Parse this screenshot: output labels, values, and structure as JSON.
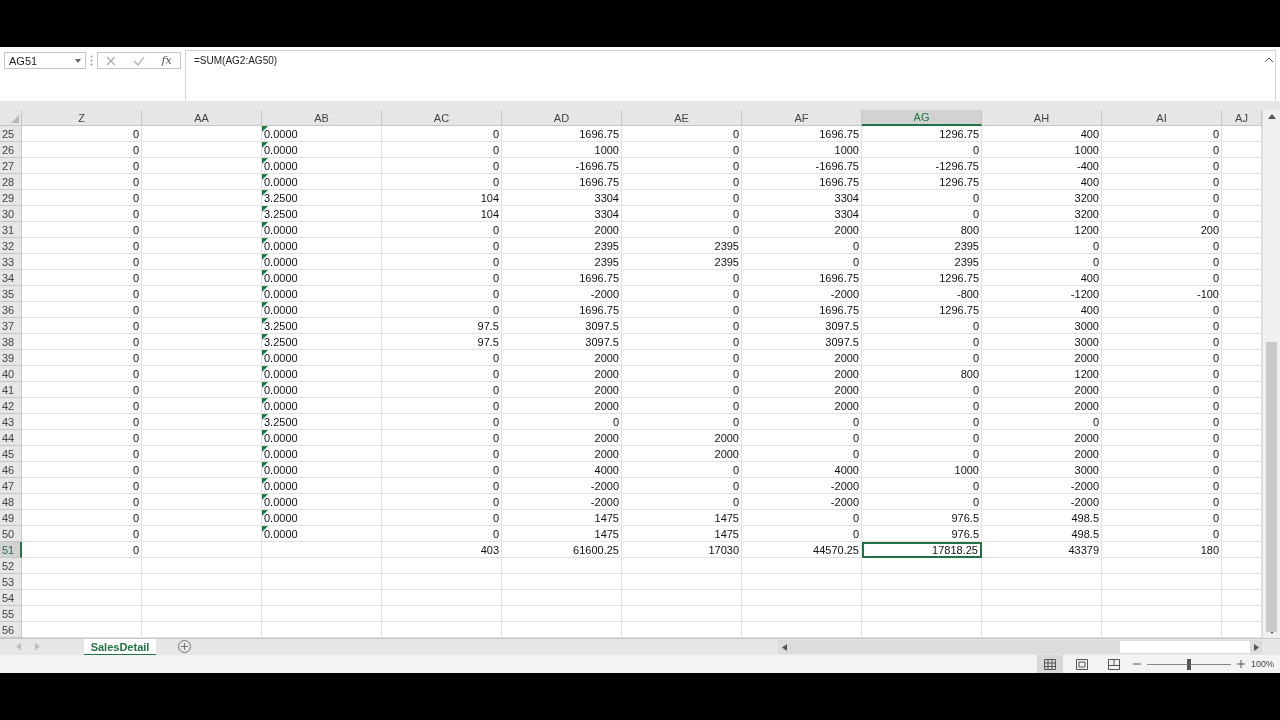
{
  "formula_bar": {
    "name_box": "AG51",
    "function_label": "fx",
    "formula": "=SUM(AG2:AG50)"
  },
  "columns": [
    {
      "label": "Z",
      "selected": false
    },
    {
      "label": "AA",
      "selected": false
    },
    {
      "label": "AB",
      "selected": false
    },
    {
      "label": "AC",
      "selected": false
    },
    {
      "label": "AD",
      "selected": false
    },
    {
      "label": "AE",
      "selected": false
    },
    {
      "label": "AF",
      "selected": false
    },
    {
      "label": "AG",
      "selected": true
    },
    {
      "label": "AH",
      "selected": false
    },
    {
      "label": "AI",
      "selected": false
    },
    {
      "label": "AJ",
      "selected": false
    }
  ],
  "rows": [
    {
      "number": "25",
      "selected": false,
      "cells": [
        "0",
        null,
        {
          "text": "0.0000",
          "flag": true
        },
        "0",
        "1696.75",
        "0",
        "1696.75",
        "1296.75",
        "400",
        "0"
      ]
    },
    {
      "number": "26",
      "selected": false,
      "cells": [
        "0",
        null,
        {
          "text": "0.0000",
          "flag": true
        },
        "0",
        "1000",
        "0",
        "1000",
        "0",
        "1000",
        "0"
      ]
    },
    {
      "number": "27",
      "selected": false,
      "cells": [
        "0",
        null,
        {
          "text": "0.0000",
          "flag": true
        },
        "0",
        "-1696.75",
        "0",
        "-1696.75",
        "-1296.75",
        "-400",
        "0"
      ]
    },
    {
      "number": "28",
      "selected": false,
      "cells": [
        "0",
        null,
        {
          "text": "0.0000",
          "flag": true
        },
        "0",
        "1696.75",
        "0",
        "1696.75",
        "1296.75",
        "400",
        "0"
      ]
    },
    {
      "number": "29",
      "selected": false,
      "cells": [
        "0",
        null,
        {
          "text": "3.2500",
          "flag": true
        },
        "104",
        "3304",
        "0",
        "3304",
        "0",
        "3200",
        "0"
      ]
    },
    {
      "number": "30",
      "selected": false,
      "cells": [
        "0",
        null,
        {
          "text": "3.2500",
          "flag": true
        },
        "104",
        "3304",
        "0",
        "3304",
        "0",
        "3200",
        "0"
      ]
    },
    {
      "number": "31",
      "selected": false,
      "cells": [
        "0",
        null,
        {
          "text": "0.0000",
          "flag": true
        },
        "0",
        "2000",
        "0",
        "2000",
        "800",
        "1200",
        "200"
      ]
    },
    {
      "number": "32",
      "selected": false,
      "cells": [
        "0",
        null,
        {
          "text": "0.0000",
          "flag": true
        },
        "0",
        "2395",
        "2395",
        "0",
        "2395",
        "0",
        "0"
      ]
    },
    {
      "number": "33",
      "selected": false,
      "cells": [
        "0",
        null,
        {
          "text": "0.0000",
          "flag": true
        },
        "0",
        "2395",
        "2395",
        "0",
        "2395",
        "0",
        "0"
      ]
    },
    {
      "number": "34",
      "selected": false,
      "cells": [
        "0",
        null,
        {
          "text": "0.0000",
          "flag": true
        },
        "0",
        "1696.75",
        "0",
        "1696.75",
        "1296.75",
        "400",
        "0"
      ]
    },
    {
      "number": "35",
      "selected": false,
      "cells": [
        "0",
        null,
        {
          "text": "0.0000",
          "flag": true
        },
        "0",
        "-2000",
        "0",
        "-2000",
        "-800",
        "-1200",
        "-100"
      ]
    },
    {
      "number": "36",
      "selected": false,
      "cells": [
        "0",
        null,
        {
          "text": "0.0000",
          "flag": true
        },
        "0",
        "1696.75",
        "0",
        "1696.75",
        "1296.75",
        "400",
        "0"
      ]
    },
    {
      "number": "37",
      "selected": false,
      "cells": [
        "0",
        null,
        {
          "text": "3.2500",
          "flag": true
        },
        "97.5",
        "3097.5",
        "0",
        "3097.5",
        "0",
        "3000",
        "0"
      ]
    },
    {
      "number": "38",
      "selected": false,
      "cells": [
        "0",
        null,
        {
          "text": "3.2500",
          "flag": true
        },
        "97.5",
        "3097.5",
        "0",
        "3097.5",
        "0",
        "3000",
        "0"
      ]
    },
    {
      "number": "39",
      "selected": false,
      "cells": [
        "0",
        null,
        {
          "text": "0.0000",
          "flag": true
        },
        "0",
        "2000",
        "0",
        "2000",
        "0",
        "2000",
        "0"
      ]
    },
    {
      "number": "40",
      "selected": false,
      "cells": [
        "0",
        null,
        {
          "text": "0.0000",
          "flag": true
        },
        "0",
        "2000",
        "0",
        "2000",
        "800",
        "1200",
        "0"
      ]
    },
    {
      "number": "41",
      "selected": false,
      "cells": [
        "0",
        null,
        {
          "text": "0.0000",
          "flag": true
        },
        "0",
        "2000",
        "0",
        "2000",
        "0",
        "2000",
        "0"
      ]
    },
    {
      "number": "42",
      "selected": false,
      "cells": [
        "0",
        null,
        {
          "text": "0.0000",
          "flag": true
        },
        "0",
        "2000",
        "0",
        "2000",
        "0",
        "2000",
        "0"
      ]
    },
    {
      "number": "43",
      "selected": false,
      "cells": [
        "0",
        null,
        {
          "text": "3.2500",
          "flag": true
        },
        "0",
        "0",
        "0",
        "0",
        "0",
        "0",
        "0"
      ]
    },
    {
      "number": "44",
      "selected": false,
      "cells": [
        "0",
        null,
        {
          "text": "0.0000",
          "flag": true
        },
        "0",
        "2000",
        "2000",
        "0",
        "0",
        "2000",
        "0"
      ]
    },
    {
      "number": "45",
      "selected": false,
      "cells": [
        "0",
        null,
        {
          "text": "0.0000",
          "flag": true
        },
        "0",
        "2000",
        "2000",
        "0",
        "0",
        "2000",
        "0"
      ]
    },
    {
      "number": "46",
      "selected": false,
      "cells": [
        "0",
        null,
        {
          "text": "0.0000",
          "flag": true
        },
        "0",
        "4000",
        "0",
        "4000",
        "1000",
        "3000",
        "0"
      ]
    },
    {
      "number": "47",
      "selected": false,
      "cells": [
        "0",
        null,
        {
          "text": "0.0000",
          "flag": true
        },
        "0",
        "-2000",
        "0",
        "-2000",
        "0",
        "-2000",
        "0"
      ]
    },
    {
      "number": "48",
      "selected": false,
      "cells": [
        "0",
        null,
        {
          "text": "0.0000",
          "flag": true
        },
        "0",
        "-2000",
        "0",
        "-2000",
        "0",
        "-2000",
        "0"
      ]
    },
    {
      "number": "49",
      "selected": false,
      "cells": [
        "0",
        null,
        {
          "text": "0.0000",
          "flag": true
        },
        "0",
        "1475",
        "1475",
        "0",
        "976.5",
        "498.5",
        "0"
      ]
    },
    {
      "number": "50",
      "selected": false,
      "cells": [
        "0",
        null,
        {
          "text": "0.0000",
          "flag": true
        },
        "0",
        "1475",
        "1475",
        "0",
        "976.5",
        "498.5",
        "0"
      ]
    },
    {
      "number": "51",
      "selected": true,
      "cells": [
        "0",
        null,
        null,
        "403",
        "61600.25",
        "17030",
        "44570.25",
        "17818.25",
        "43379",
        "180"
      ]
    },
    {
      "number": "52",
      "selected": false,
      "cells": []
    },
    {
      "number": "53",
      "selected": false,
      "cells": []
    },
    {
      "number": "54",
      "selected": false,
      "cells": []
    },
    {
      "number": "55",
      "selected": false,
      "cells": []
    },
    {
      "number": "56",
      "selected": false,
      "cells": []
    }
  ],
  "sheet_tabs": [
    {
      "label": "SalesDetail",
      "selected": true
    }
  ],
  "status_bar": {
    "views": [
      {
        "kind": "normal",
        "selected": true
      },
      {
        "kind": "page_layout",
        "selected": false
      },
      {
        "kind": "page_break",
        "selected": false
      }
    ],
    "zoom": {
      "level": 0.5,
      "reading": "100%"
    }
  }
}
